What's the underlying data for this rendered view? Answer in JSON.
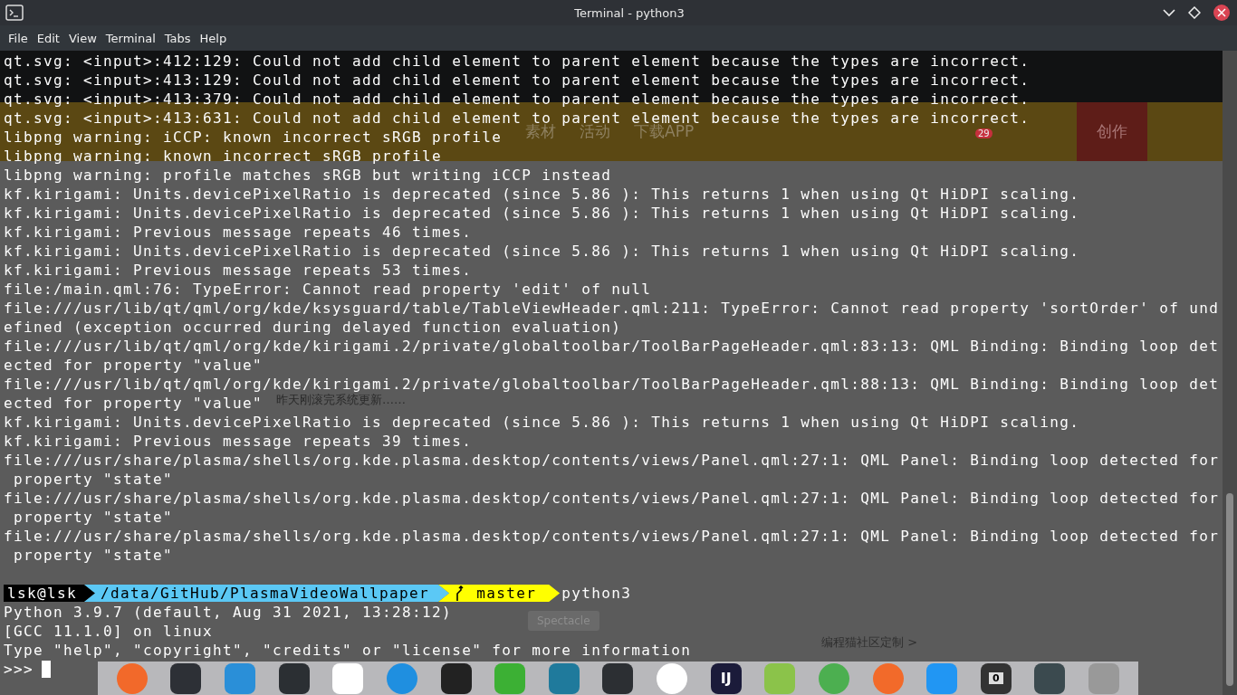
{
  "window": {
    "title": "Terminal - python3"
  },
  "menu": [
    "File",
    "Edit",
    "View",
    "Terminal",
    "Tabs",
    "Help"
  ],
  "lines": [
    "qt.svg: <input>:412:129: Could not add child element to parent element because the types are incorrect.",
    "qt.svg: <input>:413:129: Could not add child element to parent element because the types are incorrect.",
    "qt.svg: <input>:413:379: Could not add child element to parent element because the types are incorrect.",
    "qt.svg: <input>:413:631: Could not add child element to parent element because the types are incorrect.",
    "libpng warning: iCCP: known incorrect sRGB profile",
    "libpng warning: known incorrect sRGB profile",
    "libpng warning: profile matches sRGB but writing iCCP instead",
    "kf.kirigami: Units.devicePixelRatio is deprecated (since 5.86 ): This returns 1 when using Qt HiDPI scaling.",
    "kf.kirigami: Units.devicePixelRatio is deprecated (since 5.86 ): This returns 1 when using Qt HiDPI scaling.",
    "kf.kirigami: Previous message repeats 46 times.",
    "kf.kirigami: Units.devicePixelRatio is deprecated (since 5.86 ): This returns 1 when using Qt HiDPI scaling.",
    "kf.kirigami: Previous message repeats 53 times.",
    "file:/main.qml:76: TypeError: Cannot read property 'edit' of null",
    "file:///usr/lib/qt/qml/org/kde/ksysguard/table/TableViewHeader.qml:211: TypeError: Cannot read property 'sortOrder' of und",
    "efined (exception occurred during delayed function evaluation)",
    "file:///usr/lib/qt/qml/org/kde/kirigami.2/private/globaltoolbar/ToolBarPageHeader.qml:83:13: QML Binding: Binding loop det",
    "ected for property \"value\"",
    "file:///usr/lib/qt/qml/org/kde/kirigami.2/private/globaltoolbar/ToolBarPageHeader.qml:88:13: QML Binding: Binding loop det",
    "ected for property \"value\"",
    "kf.kirigami: Units.devicePixelRatio is deprecated (since 5.86 ): This returns 1 when using Qt HiDPI scaling.",
    "kf.kirigami: Previous message repeats 39 times.",
    "file:///usr/share/plasma/shells/org.kde.plasma.desktop/contents/views/Panel.qml:27:1: QML Panel: Binding loop detected for",
    " property \"state\"",
    "file:///usr/share/plasma/shells/org.kde.plasma.desktop/contents/views/Panel.qml:27:1: QML Panel: Binding loop detected for",
    " property \"state\"",
    "file:///usr/share/plasma/shells/org.kde.plasma.desktop/contents/views/Panel.qml:27:1: QML Panel: Binding loop detected for",
    " property \"state\""
  ],
  "prompt": {
    "user": "lsk@lsk",
    "path": "/data/GitHub/PlasmaVideoWallpaper",
    "branch": "master",
    "command": "python3"
  },
  "output": [
    "Python 3.9.7 (default, Aug 31 2021, 13:28:12)",
    "[GCC 11.1.0] on linux",
    "Type \"help\", \"copyright\", \"credits\" or \"license\" for more information"
  ],
  "input_prompt": ">>>",
  "background_page": {
    "nav": [
      "素材",
      "活动",
      "下载APP"
    ],
    "notification_count": "29",
    "create_button": "创作",
    "reply_text": "昨天刚滚完系统更新……",
    "tooltip": "Spectacle",
    "rules_link": "编程猫社区定制 >"
  },
  "dock": [
    {
      "kind": "fox"
    },
    {
      "kind": "sliders"
    },
    {
      "kind": "folder"
    },
    {
      "kind": "terminal"
    },
    {
      "kind": "cloud"
    },
    {
      "kind": "bird"
    },
    {
      "kind": "penguin"
    },
    {
      "kind": "chat"
    },
    {
      "kind": "camera"
    },
    {
      "kind": "cassette"
    },
    {
      "kind": "beaver"
    },
    {
      "kind": "ij",
      "label": "IJ"
    },
    {
      "kind": "mc"
    },
    {
      "kind": "compass"
    },
    {
      "kind": "pen"
    },
    {
      "kind": "document"
    },
    {
      "kind": "calculator",
      "label": "0"
    },
    {
      "kind": "graph"
    },
    {
      "kind": "gear"
    }
  ]
}
